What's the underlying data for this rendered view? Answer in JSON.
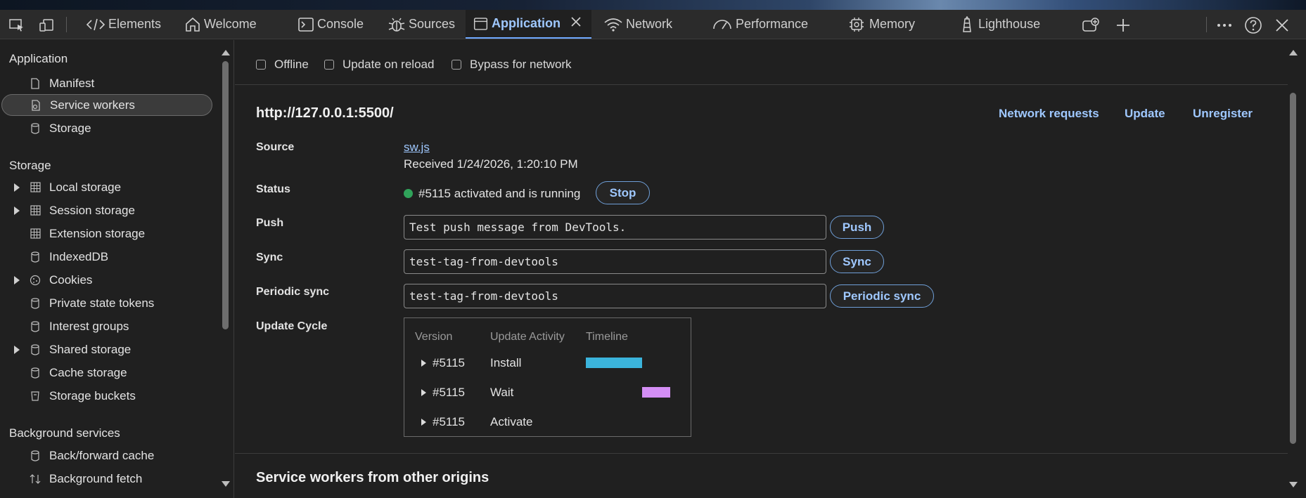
{
  "toolbar_tabs": [
    {
      "label": "Elements",
      "icon": "code-icon"
    },
    {
      "label": "Welcome",
      "icon": "home-icon"
    },
    {
      "label": "Console",
      "icon": "console-icon"
    },
    {
      "label": "Sources",
      "icon": "bug-icon"
    },
    {
      "label": "Application",
      "icon": "window-icon",
      "active": true
    },
    {
      "label": "Network",
      "icon": "wifi-icon"
    },
    {
      "label": "Performance",
      "icon": "gauge-icon"
    },
    {
      "label": "Memory",
      "icon": "chip-icon"
    },
    {
      "label": "Lighthouse",
      "icon": "lighthouse-icon"
    }
  ],
  "sidebar": {
    "sections": {
      "application": "Application",
      "storage": "Storage",
      "background": "Background services"
    },
    "application_items": [
      "Manifest",
      "Service workers",
      "Storage"
    ],
    "storage_items": [
      "Local storage",
      "Session storage",
      "Extension storage",
      "IndexedDB",
      "Cookies",
      "Private state tokens",
      "Interest groups",
      "Shared storage",
      "Cache storage",
      "Storage buckets"
    ],
    "background_items": [
      "Back/forward cache",
      "Background fetch"
    ]
  },
  "main": {
    "checkboxes": {
      "offline": "Offline",
      "update_on_reload": "Update on reload",
      "bypass": "Bypass for network"
    },
    "origin": "http://127.0.0.1:5500/",
    "links": {
      "network_requests": "Network requests",
      "update": "Update",
      "unregister": "Unregister"
    },
    "labels": {
      "source": "Source",
      "status": "Status",
      "push": "Push",
      "sync": "Sync",
      "periodic_sync": "Periodic sync",
      "update_cycle": "Update Cycle"
    },
    "source_file": "sw.js",
    "received": "Received 1/24/2026, 1:20:10 PM",
    "status_text": "#5115 activated and is running",
    "status_color": "#30a35a",
    "buttons": {
      "stop": "Stop",
      "push": "Push",
      "sync": "Sync",
      "periodic_sync": "Periodic sync"
    },
    "inputs": {
      "push": "Test push message from DevTools.",
      "sync": "test-tag-from-devtools",
      "periodic_sync": "test-tag-from-devtools"
    },
    "cycle": {
      "headers": {
        "version": "Version",
        "activity": "Update Activity",
        "timeline": "Timeline"
      },
      "rows": [
        {
          "version": "#5115",
          "activity": "Install",
          "bar_color": "#3bb4dc"
        },
        {
          "version": "#5115",
          "activity": "Wait",
          "bar_color": "#d48ef5"
        },
        {
          "version": "#5115",
          "activity": "Activate"
        }
      ]
    },
    "other_origins_title": "Service workers from other origins"
  }
}
